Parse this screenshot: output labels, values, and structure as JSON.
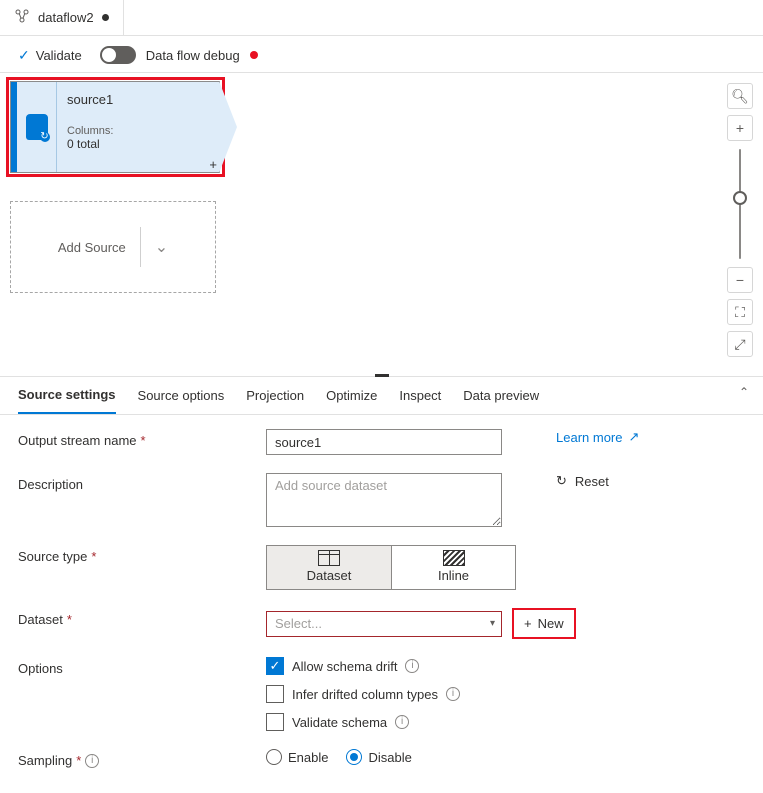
{
  "tab": {
    "title": "dataflow2"
  },
  "toolbar": {
    "validate": "Validate",
    "dataflow_debug": "Data flow debug"
  },
  "canvas": {
    "source_node": {
      "title": "source1",
      "columns_label": "Columns:",
      "columns_value": "0 total"
    },
    "add_source": "Add Source"
  },
  "panel": {
    "tabs": [
      "Source settings",
      "Source options",
      "Projection",
      "Optimize",
      "Inspect",
      "Data preview"
    ],
    "form": {
      "output_stream_name_label": "Output stream name",
      "output_stream_name_value": "source1",
      "learn_more": "Learn more",
      "description_label": "Description",
      "description_placeholder": "Add source dataset",
      "reset": "Reset",
      "source_type_label": "Source type",
      "source_type_options": {
        "dataset": "Dataset",
        "inline": "Inline"
      },
      "dataset_label": "Dataset",
      "dataset_placeholder": "Select...",
      "new_button": "New",
      "options_label": "Options",
      "options": {
        "allow_schema_drift": "Allow schema drift",
        "infer_drifted": "Infer drifted column types",
        "validate_schema": "Validate schema"
      },
      "sampling_label": "Sampling",
      "sampling_options": {
        "enable": "Enable",
        "disable": "Disable"
      }
    }
  }
}
